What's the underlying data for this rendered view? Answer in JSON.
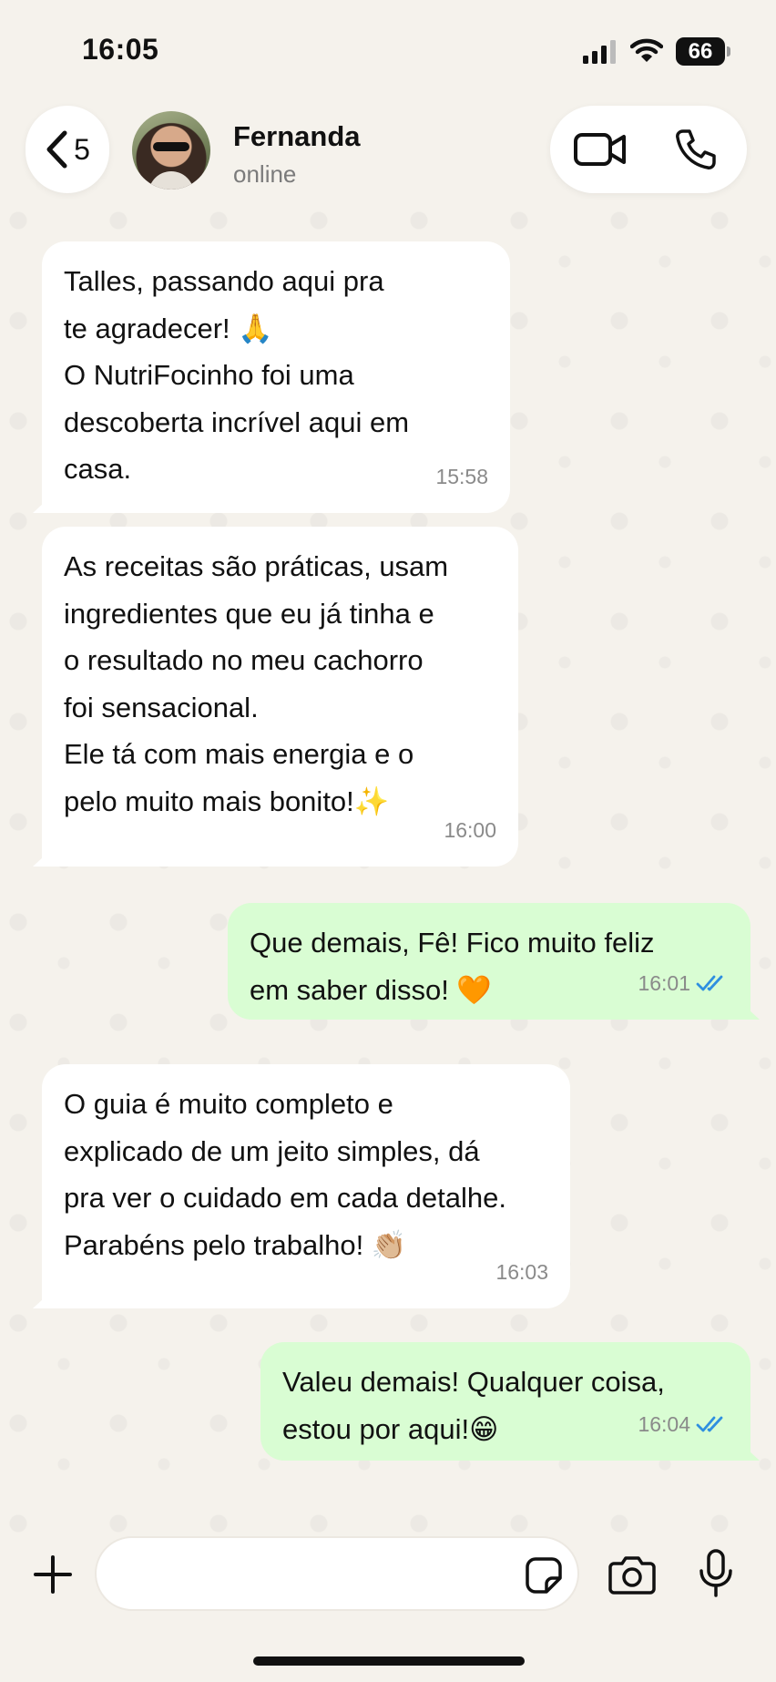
{
  "status_bar": {
    "time": "16:05",
    "battery": "66"
  },
  "header": {
    "back_count": "5",
    "contact_name": "Fernanda",
    "contact_status": "online"
  },
  "messages": [
    {
      "direction": "in",
      "text": "Talles, passando aqui pra\nte agradecer! 🙏\nO NutriFocinho foi uma\ndescoberta incrível aqui em\ncasa.",
      "time": "15:58"
    },
    {
      "direction": "in",
      "text": "As receitas são práticas, usam\ningredientes que eu já tinha e\no resultado no meu cachorro\nfoi sensacional.\nEle tá com mais energia e o\npelo muito mais bonito!✨",
      "time": "16:00"
    },
    {
      "direction": "out",
      "text": "Que demais, Fê! Fico muito feliz\nem saber disso! 🧡",
      "time": "16:01",
      "read": true
    },
    {
      "direction": "in",
      "text": "O guia é muito completo e\nexplicado de um jeito simples, dá\npra ver o cuidado em cada detalhe.\nParabéns pelo trabalho! 👏🏼",
      "time": "16:03"
    },
    {
      "direction": "out",
      "text": "Valeu demais! Qualquer coisa,\nestou por aqui!😁",
      "time": "16:04",
      "read": true
    }
  ],
  "input": {
    "placeholder": ""
  },
  "colors": {
    "outgoing_bubble": "#d9fdd3",
    "incoming_bubble": "#ffffff",
    "read_check": "#2f8fe0"
  },
  "icons": [
    "back-chevron-icon",
    "video-call-icon",
    "phone-icon",
    "plus-icon",
    "sticker-icon",
    "camera-icon",
    "mic-icon"
  ]
}
